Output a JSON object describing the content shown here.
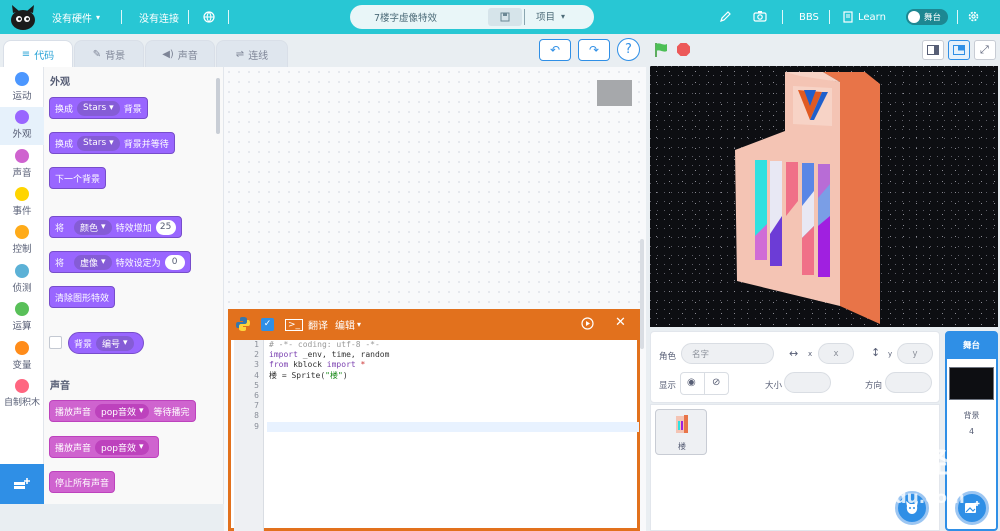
{
  "topbar": {
    "hardware_label": "没有硬件",
    "connection_label": "没有连接",
    "project_name": "7楼字虚像特效",
    "project_menu": "项目",
    "bbs_label": "BBS",
    "learn_label": "Learn",
    "stage_toggle_label": "舞台"
  },
  "tabs": {
    "code": "代码",
    "backdrops": "背景",
    "sounds": "声音",
    "connect": "连线"
  },
  "categories": [
    {
      "label": "运动",
      "color": "#4c97ff"
    },
    {
      "label": "外观",
      "color": "#9966ff"
    },
    {
      "label": "声音",
      "color": "#cf63cf"
    },
    {
      "label": "事件",
      "color": "#ffd500"
    },
    {
      "label": "控制",
      "color": "#ffab19"
    },
    {
      "label": "侦测",
      "color": "#5cb1d6"
    },
    {
      "label": "运算",
      "color": "#59c059"
    },
    {
      "label": "变量",
      "color": "#ff8c1a"
    },
    {
      "label": "自制积木",
      "color": "#ff6680"
    }
  ],
  "palette": {
    "looks_title": "外观",
    "switch_backdrop": {
      "text": "换成",
      "menu": "Stars",
      "suffix": "背景"
    },
    "switch_backdrop_wait": {
      "text": "换成",
      "menu": "Stars",
      "suffix": "背景并等待"
    },
    "next_backdrop": "下一个背景",
    "change_effect": {
      "text": "将",
      "menu": "颜色",
      "suffix": "特效增加",
      "value": "25"
    },
    "set_effect": {
      "text": "将",
      "menu": "虚像",
      "suffix": "特效设定为",
      "value": "0"
    },
    "clear_effects": "清除图形特效",
    "backdrop_reporter": {
      "text": "背景",
      "menu": "编号"
    },
    "sound_title": "声音",
    "play_until_done": {
      "text": "播放声音",
      "menu": "pop音效",
      "suffix": "等待播完"
    },
    "start_sound": {
      "text": "播放声音",
      "menu": "pop音效"
    },
    "stop_sounds": "停止所有声音"
  },
  "editor": {
    "translate_label": "翻译",
    "edit_label": "编辑",
    "line_numbers": [
      "1",
      "2",
      "3",
      "4",
      "5",
      "6",
      "7",
      "8",
      "9"
    ],
    "lines": [
      "# -*- coding: utf-8 -*-",
      "import _env, time, random",
      "from kblock import *",
      "楼 = Sprite(\"楼\")",
      "",
      "",
      "",
      "",
      ""
    ]
  },
  "sprite_info": {
    "sprite_label": "角色",
    "name_placeholder": "名字",
    "x_placeholder": "x",
    "y_placeholder": "y",
    "x_label": "x",
    "y_label": "y",
    "show_label": "显示",
    "size_label": "大小",
    "direction_label": "方向"
  },
  "sprites": [
    {
      "name": "楼"
    }
  ],
  "stage_panel": {
    "title": "舞台",
    "backdrops_label": "背景",
    "backdrop_count": "4"
  },
  "watermark": {
    "line1": "Bai",
    "line1b": "du",
    "line1c": "经验",
    "line2": "jingyan.baidu.com"
  },
  "colors": {
    "topbar": "#28c7d4",
    "accent": "#2f8fe6",
    "editor_header": "#e2711d",
    "looks": "#9966ff",
    "sound": "#cf63cf",
    "building_front": "#f4c4b4",
    "building_side": "#e87448"
  }
}
